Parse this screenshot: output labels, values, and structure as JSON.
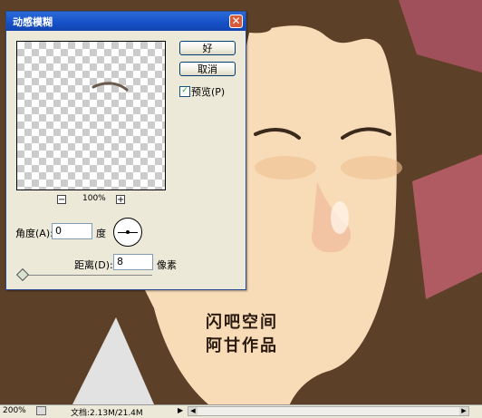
{
  "dialog": {
    "title": "动感模糊",
    "ok_label": "好",
    "cancel_label": "取消",
    "preview_label": "预览(P)",
    "preview_checked": true,
    "zoom_minus": "−",
    "zoom_plus": "+",
    "zoom_level": "100%",
    "angle_label": "角度(A):",
    "angle_value": "0",
    "angle_unit": "度",
    "distance_label": "距离(D):",
    "distance_value": "8",
    "distance_unit": "像素",
    "slider_value": 8
  },
  "canvas": {
    "watermark_line1": "闪吧空间",
    "watermark_line2": "阿甘作品"
  },
  "statusbar": {
    "zoom": "200%",
    "doc_info": "文档:2.13M/21.4M",
    "arrow": "▶"
  },
  "colors": {
    "background": "#5c4128",
    "skin": "#f8dcb8",
    "titlebar": "#1650c6",
    "dialog_bg": "#ece9d8",
    "red_shape": "#b05a62"
  }
}
